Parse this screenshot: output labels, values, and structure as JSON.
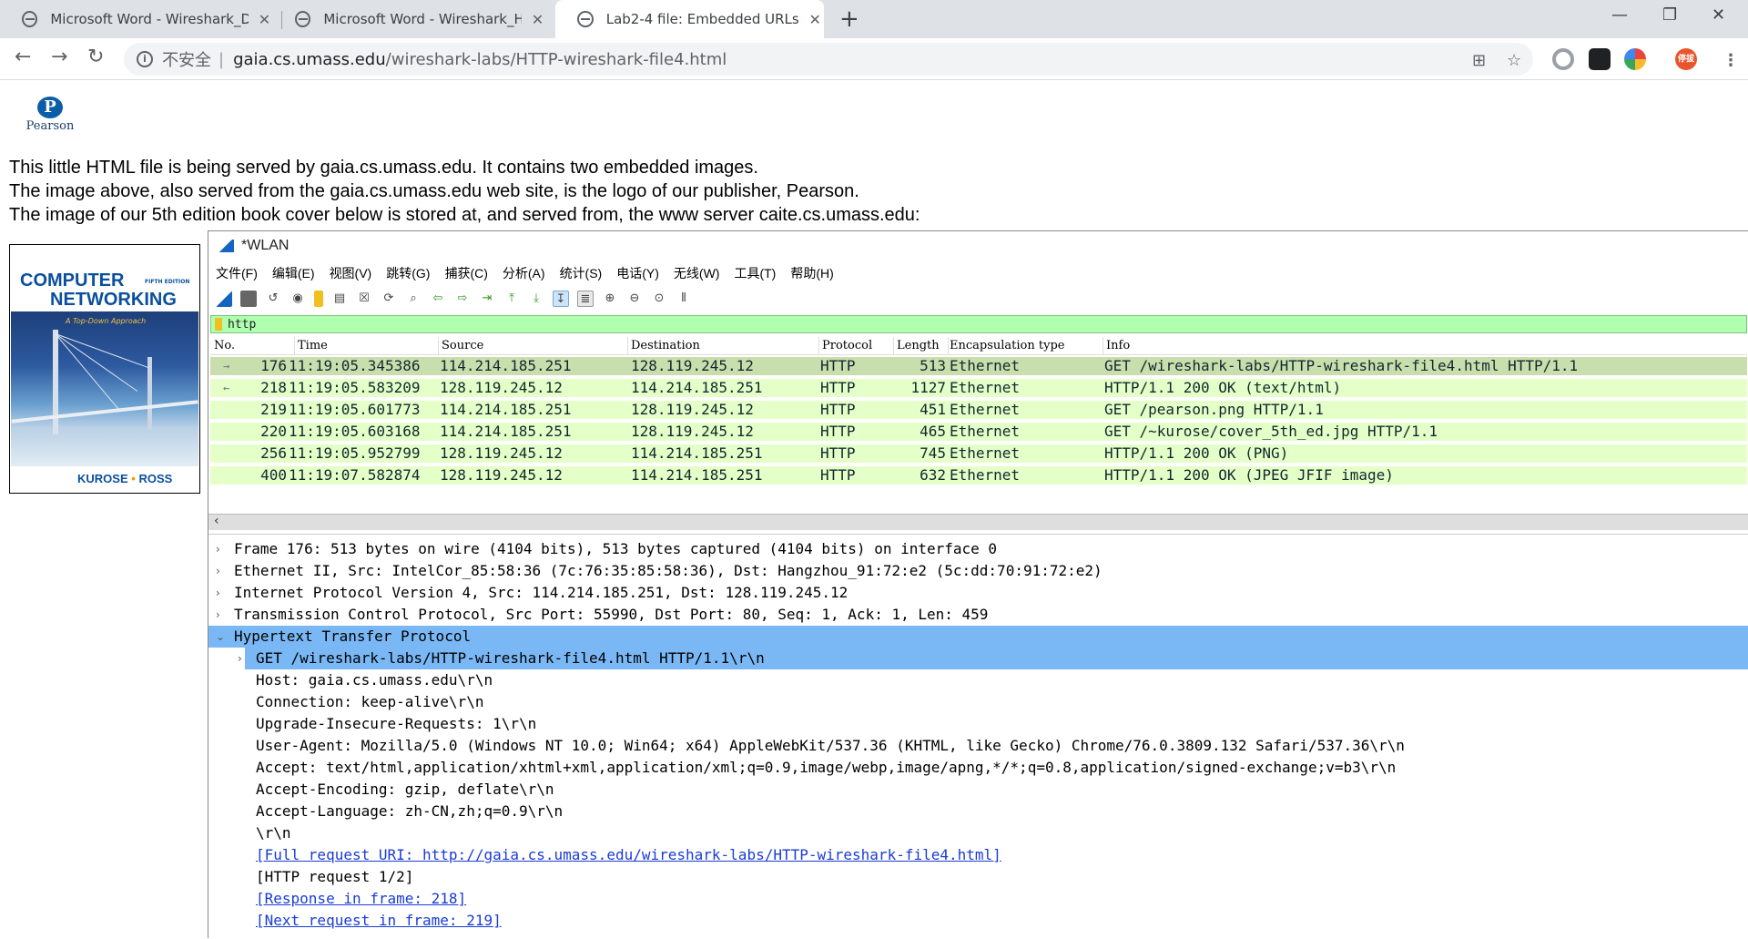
{
  "browser": {
    "tabs": [
      {
        "title": "Microsoft Word - Wireshark_D",
        "active": false
      },
      {
        "title": "Microsoft Word - Wireshark_H",
        "active": false
      },
      {
        "title": "Lab2-4 file: Embedded URLs",
        "active": true
      }
    ],
    "new_tab_icon": "+",
    "window_controls": [
      "—",
      "❐",
      "✕"
    ],
    "address": {
      "security_label": "不安全",
      "host": "gaia.cs.umass.edu",
      "path": "/wireshark-labs/HTTP-wireshark-file4.html"
    },
    "profile_badge": "停拔"
  },
  "page": {
    "logo_text": "Pearson",
    "paragraphs": [
      "This little HTML file is being served by gaia.cs.umass.edu. It contains two embedded images.",
      "The image above, also served from the gaia.cs.umass.edu web site, is the logo of our publisher, Pearson.",
      "The image of our 5th edition book cover below is stored at, and served from, the www server caite.cs.umass.edu:"
    ],
    "book": {
      "line1": "COMPUTER",
      "edition": "FIFTH EDITION",
      "line2": "NETWORKING",
      "subtitle": "A Top-Down Approach",
      "author1": "KUROSE",
      "author_sep": "•",
      "author2": "ROSS"
    }
  },
  "wireshark": {
    "title": "*WLAN",
    "menu": [
      "文件(F)",
      "编辑(E)",
      "视图(V)",
      "跳转(G)",
      "捕获(C)",
      "分析(A)",
      "统计(S)",
      "电话(Y)",
      "无线(W)",
      "工具(T)",
      "帮助(H)"
    ],
    "filter": "http",
    "columns": [
      "No.",
      "Time",
      "Source",
      "Destination",
      "Protocol",
      "Length",
      "Encapsulation type",
      "Info"
    ],
    "packets": [
      {
        "no": "176",
        "time": "11:19:05.345386",
        "src": "114.214.185.251",
        "dst": "128.119.245.12",
        "proto": "HTTP",
        "len": "513",
        "encap": "Ethernet",
        "info": "GET /wireshark-labs/HTTP-wireshark-file4.html HTTP/1.1",
        "arrow": "→",
        "selected": true
      },
      {
        "no": "218",
        "time": "11:19:05.583209",
        "src": "128.119.245.12",
        "dst": "114.214.185.251",
        "proto": "HTTP",
        "len": "1127",
        "encap": "Ethernet",
        "info": "HTTP/1.1 200 OK  (text/html)",
        "arrow": "←",
        "selected": false
      },
      {
        "no": "219",
        "time": "11:19:05.601773",
        "src": "114.214.185.251",
        "dst": "128.119.245.12",
        "proto": "HTTP",
        "len": "451",
        "encap": "Ethernet",
        "info": "GET /pearson.png HTTP/1.1",
        "arrow": "",
        "selected": false
      },
      {
        "no": "220",
        "time": "11:19:05.603168",
        "src": "114.214.185.251",
        "dst": "128.119.245.12",
        "proto": "HTTP",
        "len": "465",
        "encap": "Ethernet",
        "info": "GET /~kurose/cover_5th_ed.jpg HTTP/1.1",
        "arrow": "",
        "selected": false
      },
      {
        "no": "256",
        "time": "11:19:05.952799",
        "src": "128.119.245.12",
        "dst": "114.214.185.251",
        "proto": "HTTP",
        "len": "745",
        "encap": "Ethernet",
        "info": "HTTP/1.1 200 OK  (PNG)",
        "arrow": "",
        "selected": false
      },
      {
        "no": "400",
        "time": "11:19:07.582874",
        "src": "128.119.245.12",
        "dst": "114.214.185.251",
        "proto": "HTTP",
        "len": "632",
        "encap": "Ethernet",
        "info": "HTTP/1.1 200 OK  (JPEG JFIF image)",
        "arrow": "",
        "selected": false
      }
    ],
    "details": [
      {
        "text": "Frame 176: 513 bytes on wire (4104 bits), 513 bytes captured (4104 bits) on interface 0",
        "indent": 0,
        "chev": "›",
        "style": ""
      },
      {
        "text": "Ethernet II, Src: IntelCor_85:58:36 (7c:76:35:85:58:36), Dst: Hangzhou_91:72:e2 (5c:dd:70:91:72:e2)",
        "indent": 0,
        "chev": "›",
        "style": ""
      },
      {
        "text": "Internet Protocol Version 4, Src: 114.214.185.251, Dst: 128.119.245.12",
        "indent": 0,
        "chev": "›",
        "style": ""
      },
      {
        "text": "Transmission Control Protocol, Src Port: 55990, Dst Port: 80, Seq: 1, Ack: 1, Len: 459",
        "indent": 0,
        "chev": "›",
        "style": ""
      },
      {
        "text": "Hypertext Transfer Protocol",
        "indent": 0,
        "chev": "⌄",
        "style": "hl"
      },
      {
        "text": "GET /wireshark-labs/HTTP-wireshark-file4.html HTTP/1.1\\r\\n",
        "indent": 1,
        "chev": "›",
        "style": "hl2"
      },
      {
        "text": "Host: gaia.cs.umass.edu\\r\\n",
        "indent": 1,
        "chev": "",
        "style": ""
      },
      {
        "text": "Connection: keep-alive\\r\\n",
        "indent": 1,
        "chev": "",
        "style": ""
      },
      {
        "text": "Upgrade-Insecure-Requests: 1\\r\\n",
        "indent": 1,
        "chev": "",
        "style": ""
      },
      {
        "text": "User-Agent: Mozilla/5.0 (Windows NT 10.0; Win64; x64) AppleWebKit/537.36 (KHTML, like Gecko) Chrome/76.0.3809.132 Safari/537.36\\r\\n",
        "indent": 1,
        "chev": "",
        "style": ""
      },
      {
        "text": "Accept: text/html,application/xhtml+xml,application/xml;q=0.9,image/webp,image/apng,*/*;q=0.8,application/signed-exchange;v=b3\\r\\n",
        "indent": 1,
        "chev": "",
        "style": ""
      },
      {
        "text": "Accept-Encoding: gzip, deflate\\r\\n",
        "indent": 1,
        "chev": "",
        "style": ""
      },
      {
        "text": "Accept-Language: zh-CN,zh;q=0.9\\r\\n",
        "indent": 1,
        "chev": "",
        "style": ""
      },
      {
        "text": "\\r\\n",
        "indent": 1,
        "chev": "",
        "style": ""
      },
      {
        "text": "[Full request URI: http://gaia.cs.umass.edu/wireshark-labs/HTTP-wireshark-file4.html]",
        "indent": 1,
        "chev": "",
        "style": "link"
      },
      {
        "text": "[HTTP request 1/2]",
        "indent": 1,
        "chev": "",
        "style": ""
      },
      {
        "text": "[Response in frame: 218]",
        "indent": 1,
        "chev": "",
        "style": "link"
      },
      {
        "text": "[Next request in frame: 219]",
        "indent": 1,
        "chev": "",
        "style": "link"
      }
    ]
  },
  "colors": {
    "filter_bg": "#afffaf",
    "packet_row_bg": "#e4ffc7",
    "packet_row_selected": "#c8dfad",
    "detail_highlight": "#7ab8f5",
    "link": "#1a3bd6"
  }
}
